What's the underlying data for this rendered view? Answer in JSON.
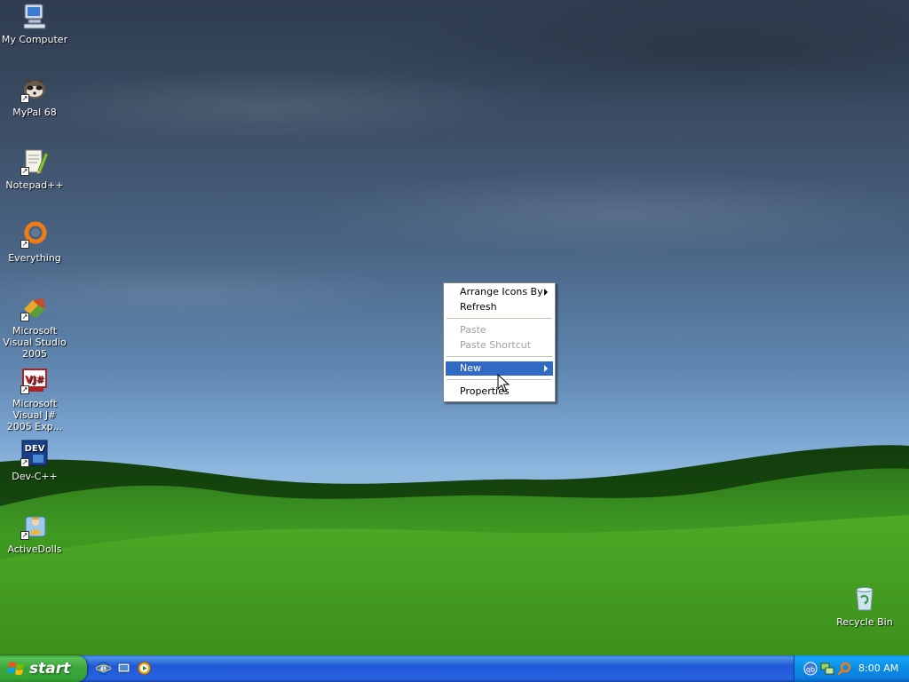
{
  "desktop": {
    "icons": [
      {
        "label": "My Computer",
        "icon": "computer-icon"
      },
      {
        "label": "MyPal 68",
        "icon": "mypal-raccoon-icon"
      },
      {
        "label": "Notepad++",
        "icon": "notepadpp-icon"
      },
      {
        "label": "Everything",
        "icon": "everything-search-icon"
      },
      {
        "label": "Microsoft Visual Studio 2005",
        "icon": "visual-studio-icon"
      },
      {
        "label": "Microsoft Visual J# 2005 Exp...",
        "icon": "visual-jsharp-icon"
      },
      {
        "label": "Dev-C++",
        "icon": "dev-cpp-icon"
      },
      {
        "label": "ActiveDolls",
        "icon": "activedolls-icon"
      }
    ],
    "recycle_bin": {
      "label": "Recycle Bin",
      "icon": "recycle-bin-icon"
    },
    "vj_badge": "VJ#",
    "dev_badge": "DEV"
  },
  "context_menu": {
    "items": [
      {
        "label": "Arrange Icons By",
        "submenu": true,
        "enabled": true
      },
      {
        "label": "Refresh",
        "submenu": false,
        "enabled": true
      },
      {
        "label": "Paste",
        "submenu": false,
        "enabled": false
      },
      {
        "label": "Paste Shortcut",
        "submenu": false,
        "enabled": false
      },
      {
        "label": "New",
        "submenu": true,
        "enabled": true,
        "selected": true
      },
      {
        "label": "Properties",
        "submenu": false,
        "enabled": true
      }
    ],
    "highlight_color": "#316ac5"
  },
  "taskbar": {
    "start_label": "start",
    "quick_launch": [
      "internet-explorer-icon",
      "show-desktop-icon",
      "media-player-icon"
    ],
    "tray_icons": [
      "qbittorrent-icon",
      "network-icon",
      "search-tray-icon"
    ],
    "tray_qb_label": "qb",
    "clock": "8:00 AM"
  },
  "colors": {
    "taskbar_blue": "#2457d4",
    "start_green": "#3ba53b",
    "tray_blue": "#0c8ce3"
  }
}
